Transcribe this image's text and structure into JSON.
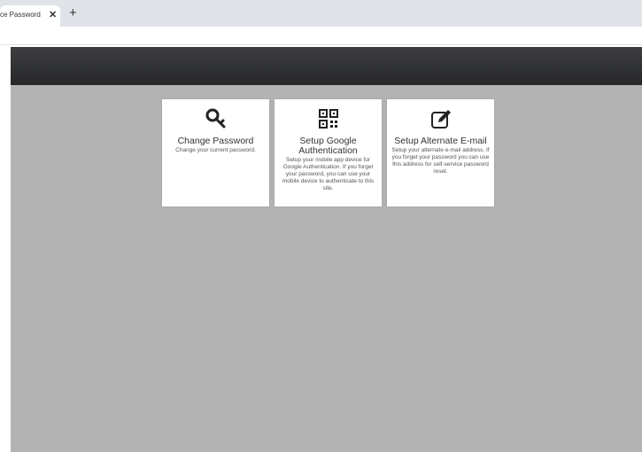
{
  "browser": {
    "tab_title": "ce Password",
    "tab_close": "✕",
    "new_tab": "+"
  },
  "cards": [
    {
      "icon": "key-icon",
      "title": "Change Password",
      "description": "Change your current password."
    },
    {
      "icon": "qr-code-icon",
      "title": "Setup Google Authentication",
      "description": "Setup your mobile app device for Google Authentication. If you forget your password, you can use your mobile device to authenticate to this site."
    },
    {
      "icon": "edit-icon",
      "title": "Setup Alternate E-mail",
      "description": "Setup your alternate e-mail address. If you forget your password you can use this address for self-service password reset."
    }
  ],
  "colors": {
    "navbar": "#2f3032",
    "background": "#b3b3b3",
    "card": "#ffffff"
  }
}
